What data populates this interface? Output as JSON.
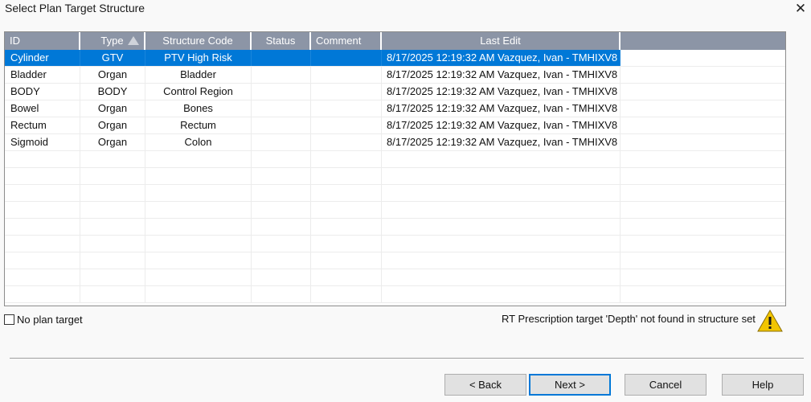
{
  "window": {
    "title": "Select Plan Target Structure",
    "close_glyph": "✕"
  },
  "table": {
    "columns": {
      "id": "ID",
      "type": "Type",
      "code": "Structure Code",
      "status": "Status",
      "comment": "Comment",
      "last_edit": "Last Edit"
    },
    "sorted_column": "Type",
    "rows": [
      {
        "id": "Cylinder",
        "type": "GTV",
        "code": "PTV High Risk",
        "status": "",
        "comment": "",
        "last_edit": "8/17/2025 12:19:32 AM Vazquez, Ivan - TMHIXV8",
        "selected": true
      },
      {
        "id": "Bladder",
        "type": "Organ",
        "code": "Bladder",
        "status": "",
        "comment": "",
        "last_edit": "8/17/2025 12:19:32 AM Vazquez, Ivan - TMHIXV8",
        "selected": false
      },
      {
        "id": "BODY",
        "type": "BODY",
        "code": "Control Region",
        "status": "",
        "comment": "",
        "last_edit": "8/17/2025 12:19:32 AM Vazquez, Ivan - TMHIXV8",
        "selected": false
      },
      {
        "id": "Bowel",
        "type": "Organ",
        "code": "Bones",
        "status": "",
        "comment": "",
        "last_edit": "8/17/2025 12:19:32 AM Vazquez, Ivan - TMHIXV8",
        "selected": false
      },
      {
        "id": "Rectum",
        "type": "Organ",
        "code": "Rectum",
        "status": "",
        "comment": "",
        "last_edit": "8/17/2025 12:19:32 AM Vazquez, Ivan - TMHIXV8",
        "selected": false
      },
      {
        "id": "Sigmoid",
        "type": "Organ",
        "code": "Colon",
        "status": "",
        "comment": "",
        "last_edit": "8/17/2025 12:19:32 AM Vazquez, Ivan - TMHIXV8",
        "selected": false
      }
    ]
  },
  "options": {
    "no_plan_target_label": "No plan target",
    "no_plan_target_checked": false
  },
  "warning": {
    "message": "RT Prescription target 'Depth' not found in structure set",
    "icon": "warning-triangle-icon"
  },
  "buttons": {
    "back": "< Back",
    "next": "Next >",
    "cancel": "Cancel",
    "help": "Help"
  },
  "colors": {
    "header_bg": "#8c95a6",
    "selection": "#0078d7",
    "warning": "#f2c500"
  }
}
